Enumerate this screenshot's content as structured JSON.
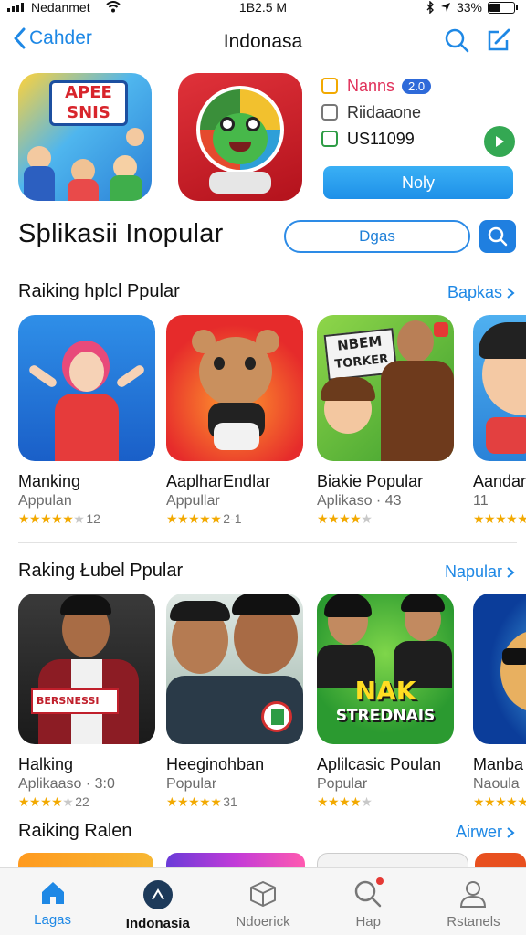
{
  "status": {
    "carrier": "Nedanmet",
    "time": "1B2.5 M",
    "battery": "33%"
  },
  "nav": {
    "back_label": "Cahder",
    "title": "Indonasa"
  },
  "hero": {
    "banner_text_1": "APEE",
    "banner_text_2": "SNIS",
    "meta_name": "Nanns",
    "meta_badge": "2.0",
    "meta_dev": "Riidaaone",
    "meta_price": "US11099",
    "action_label": "Noly"
  },
  "main": {
    "title": "Sþlikasii Inopular",
    "search_pill": "Dgas"
  },
  "sections": [
    {
      "title": "Raiking hplcl Ppular",
      "link": "Bapkas",
      "cards": [
        {
          "name": "Manking",
          "sub": "Appulan",
          "stars": 4,
          "count": "12"
        },
        {
          "name": "AaplharEndlar",
          "sub": "Appullar",
          "stars": 5,
          "count": "2-1"
        },
        {
          "name": "Biakie Popular",
          "sub": "Aplikaso · 43",
          "stars": 4,
          "count": ""
        },
        {
          "name": "Aandar",
          "sub": "11",
          "stars": 5,
          "count": ""
        }
      ]
    },
    {
      "title": "Raking Łubel Ppular",
      "link": "Napular",
      "cards": [
        {
          "name": "Halking",
          "sub": "Aplikaaso · 3:0",
          "stars": 4,
          "count": "22"
        },
        {
          "name": "Heeginohban",
          "sub": "Popular",
          "stars": 5,
          "count": "31"
        },
        {
          "name": "Aplilcasic Poulan",
          "sub": "Popular",
          "stars": 4,
          "count": ""
        },
        {
          "name": "Manba",
          "sub": "Naoula",
          "stars": 5,
          "count": ""
        }
      ]
    },
    {
      "title": "Raiking Ralen",
      "link": "Airwer"
    }
  ],
  "thumb_text": {
    "nbem_1": "NBEM",
    "nbem_2": "TORKER",
    "banner_s": "BERSNESSI",
    "nak": "NAK",
    "strednais": "STREDNAIS"
  },
  "tabs": [
    {
      "label": "Lagas"
    },
    {
      "label": "Indonasia"
    },
    {
      "label": "Ndoerick"
    },
    {
      "label": "Hap"
    },
    {
      "label": "Rstanels"
    }
  ],
  "colors": {
    "accent": "#1e88e5",
    "star": "#f2a900",
    "play": "#34a853"
  },
  "icons": [
    "signal-icon",
    "wifi-icon",
    "bluetooth-icon",
    "location-icon",
    "battery-icon",
    "back-chevron-icon",
    "search-icon",
    "compose-icon",
    "play-icon",
    "home-icon",
    "compass-icon",
    "box-icon",
    "search-tab-icon",
    "person-icon"
  ]
}
